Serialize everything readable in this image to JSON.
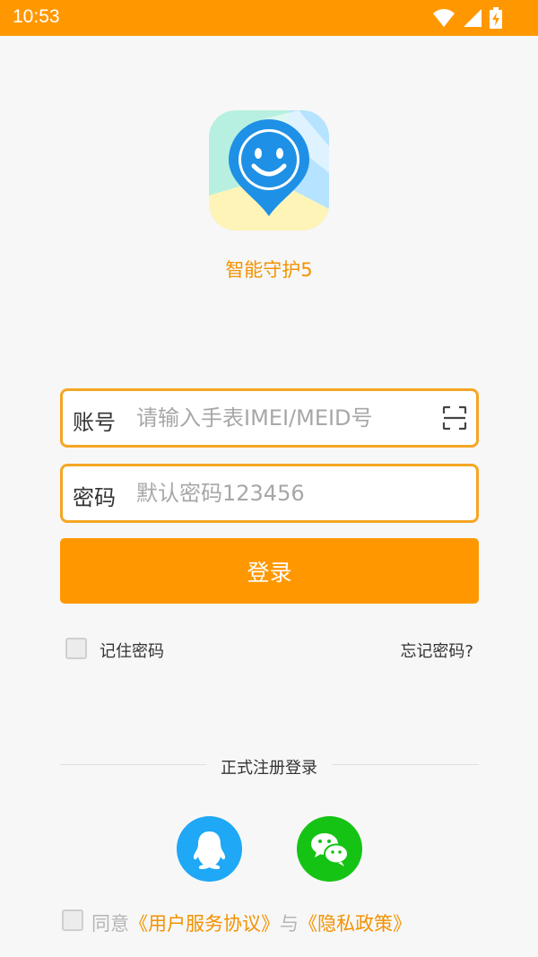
{
  "status_bar": {
    "time": "10:53",
    "icons": [
      "wifi-icon",
      "cell-signal-icon",
      "battery-charging-icon"
    ]
  },
  "app": {
    "name": "智能守护5",
    "logo_icon": "smiley-map-pin-icon"
  },
  "login_form": {
    "account_label": "账号",
    "account_placeholder": "请输入手表IMEI/MEID号",
    "account_value": "",
    "scan_icon": "scan-icon",
    "password_label": "密码",
    "password_placeholder": "默认密码123456",
    "password_value": "",
    "login_button": "登录",
    "remember_label": "记住密码",
    "remember_checked": false,
    "forgot_link": "忘记密码?"
  },
  "register": {
    "divider_text": "正式注册登录",
    "social": [
      {
        "name": "qq",
        "icon": "qq-icon",
        "color": "#1ea8f5"
      },
      {
        "name": "wechat",
        "icon": "wechat-icon",
        "color": "#15c314"
      }
    ]
  },
  "agreement": {
    "checked": false,
    "agree_text": "同意",
    "user_agreement_link": "《用户服务协议》",
    "and_text": "与",
    "privacy_link": "《隐私政策》"
  },
  "colors": {
    "accent": "#ff9800",
    "app_name": "#f39200",
    "input_border": "#f5a623"
  }
}
